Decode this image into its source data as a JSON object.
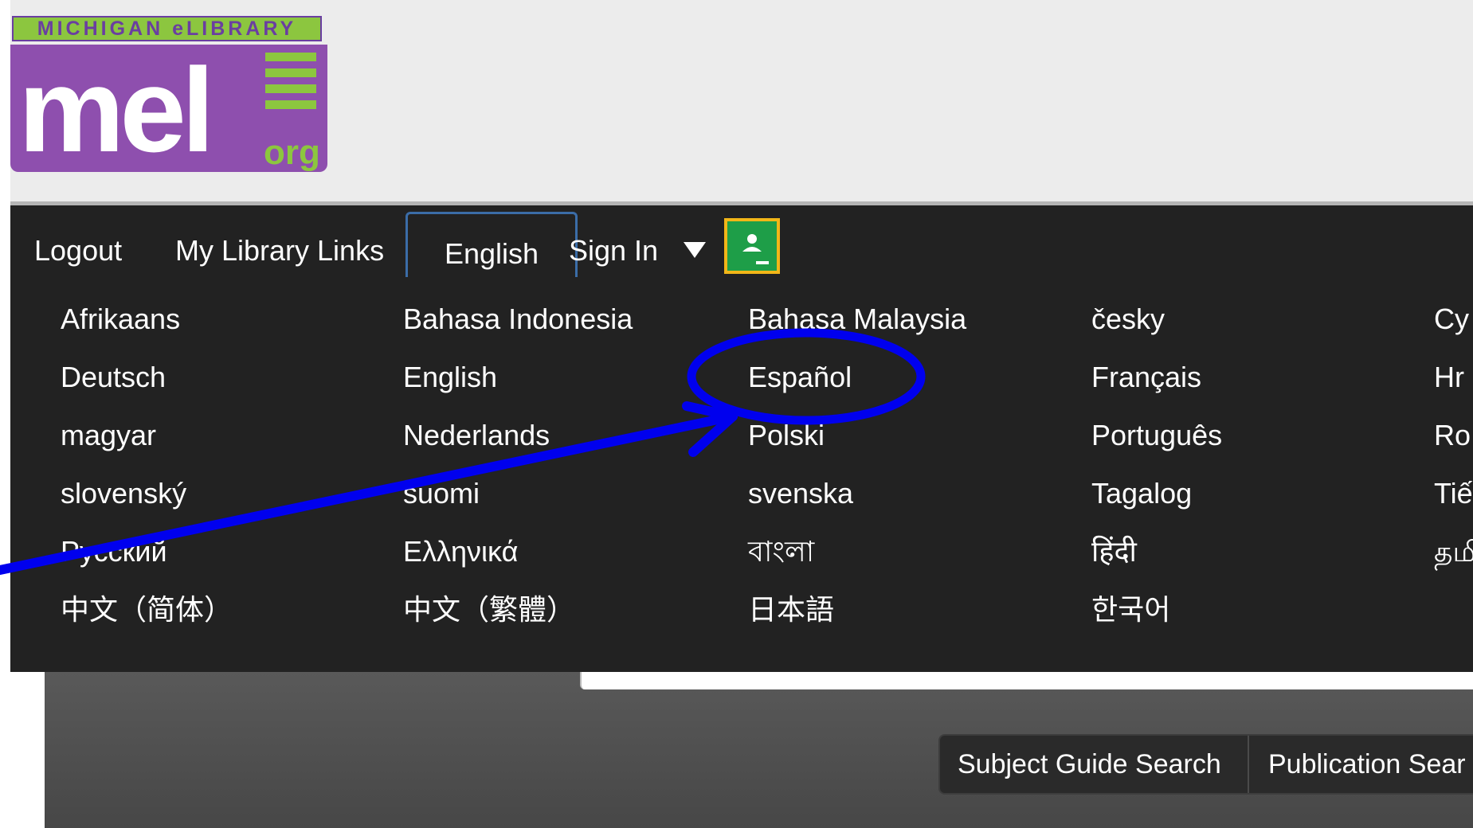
{
  "logo": {
    "banner": "MICHIGAN eLIBRARY",
    "mark": "mel",
    "suffix": "org"
  },
  "nav": {
    "logout": "Logout",
    "my_library_links": "My Library Links",
    "language_selected": "English",
    "sign_in": "Sign In",
    "classroom_icon": "google-classroom-icon"
  },
  "languages": [
    [
      "Afrikaans",
      "Bahasa Indonesia",
      "Bahasa Malaysia",
      "česky",
      "Cy"
    ],
    [
      "Deutsch",
      "English",
      "Español",
      "Français",
      "Hr"
    ],
    [
      "magyar",
      "Nederlands",
      "Polski",
      "Português",
      "Ro"
    ],
    [
      "slovenský",
      "suomi",
      "svenska",
      "Tagalog",
      "Tiế"
    ],
    [
      "Pусский",
      "Ελληνικά",
      "বাংলা",
      "हिंदी",
      "தமி"
    ],
    [
      "中文（简体）",
      "中文（繁體）",
      "日本語",
      "한국어",
      ""
    ]
  ],
  "search_tabs": {
    "subject_guide": "Subject Guide Search",
    "publication": "Publication Sear"
  },
  "colors": {
    "navbar_bg": "#222222",
    "logo_purple": "#8e4fae",
    "logo_green": "#8cc63f",
    "annotation_blue": "#0000ee",
    "tab_border": "#3b6da8",
    "classroom_green": "#1e9e48",
    "classroom_border": "#f2b618"
  }
}
